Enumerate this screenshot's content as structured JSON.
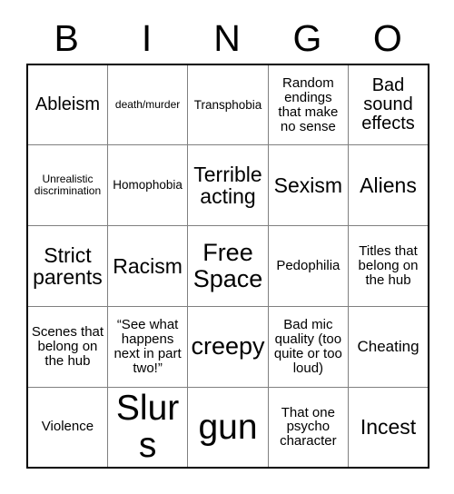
{
  "card": {
    "header_letters": [
      "B",
      "I",
      "N",
      "G",
      "O"
    ],
    "rows": [
      [
        {
          "text": "Ableism",
          "size": "fs-l"
        },
        {
          "text": "death/murder",
          "size": "fs-xxs"
        },
        {
          "text": "Transphobia",
          "size": "fs-xs"
        },
        {
          "text": "Random endings that make no sense",
          "size": "fs-s"
        },
        {
          "text": "Bad sound effects",
          "size": "fs-l"
        }
      ],
      [
        {
          "text": "Unrealistic discrimination",
          "size": "fs-xxs"
        },
        {
          "text": "Homophobia",
          "size": "fs-xs"
        },
        {
          "text": "Terrible acting",
          "size": "fs-xl"
        },
        {
          "text": "Sexism",
          "size": "fs-xl"
        },
        {
          "text": "Aliens",
          "size": "fs-xl"
        }
      ],
      [
        {
          "text": "Strict parents",
          "size": "fs-xl"
        },
        {
          "text": "Racism",
          "size": "fs-xl"
        },
        {
          "text": "Free Space",
          "size": "fs-xxl"
        },
        {
          "text": "Pedophilia",
          "size": "fs-s"
        },
        {
          "text": "Titles that belong on the hub",
          "size": "fs-s"
        }
      ],
      [
        {
          "text": "Scenes that belong on the hub",
          "size": "fs-s"
        },
        {
          "text": "“See what happens next in part two!”",
          "size": "fs-s"
        },
        {
          "text": "creepy",
          "size": "fs-xxl"
        },
        {
          "text": "Bad mic quality (too quite or too loud)",
          "size": "fs-s"
        },
        {
          "text": "Cheating",
          "size": "fs-m"
        }
      ],
      [
        {
          "text": "Violence",
          "size": "fs-s"
        },
        {
          "text": "Slurs",
          "size": "fs-huge"
        },
        {
          "text": "gun",
          "size": "fs-huge"
        },
        {
          "text": "That one psycho character",
          "size": "fs-s"
        },
        {
          "text": "Incest",
          "size": "fs-xl"
        }
      ]
    ]
  }
}
